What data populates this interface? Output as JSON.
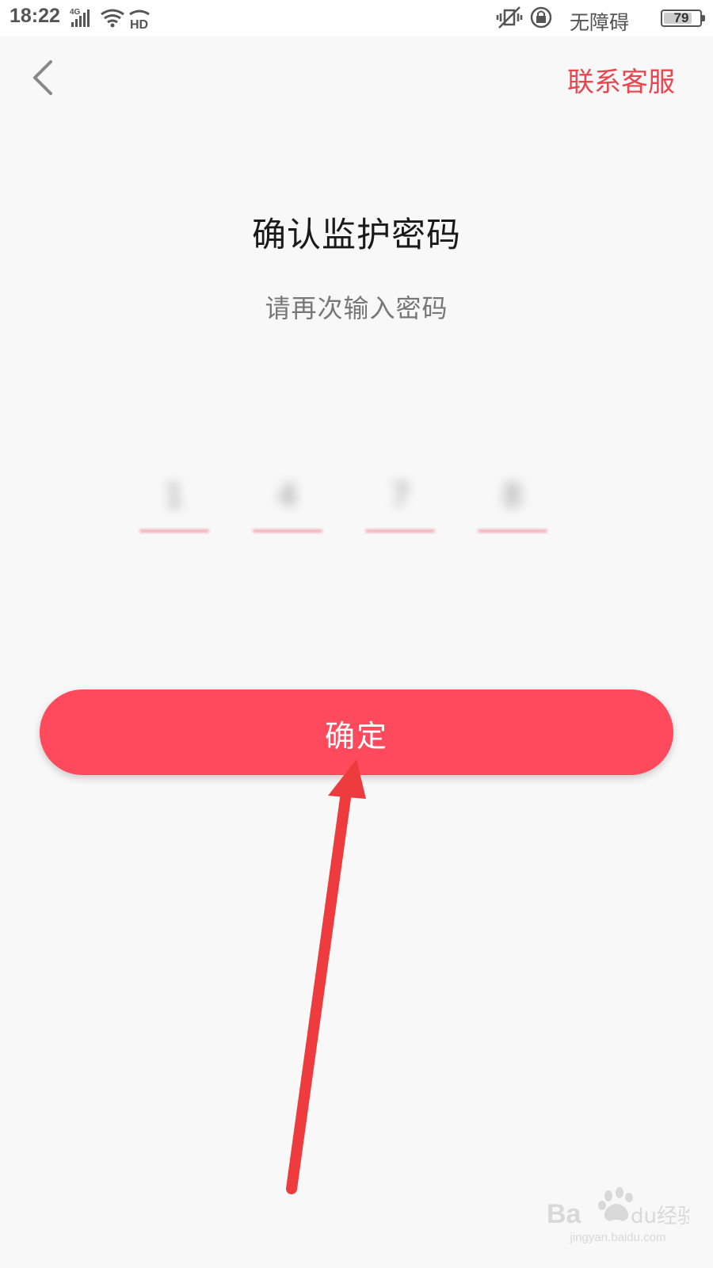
{
  "status_bar": {
    "time": "18:22",
    "network_type": "4G",
    "hd_label": "HD",
    "accessibility_label": "无障碍",
    "battery_level": "79",
    "battery_fraction": 0.79
  },
  "header": {
    "back_icon": "chevron-left-icon",
    "contact_label": "联系客服"
  },
  "main": {
    "title": "确认监护密码",
    "subtitle": "请再次输入密码",
    "pin_digits": [
      "1",
      "4",
      "7",
      "8"
    ],
    "confirm_label": "确定"
  },
  "watermark": {
    "brand": "Baidu经验",
    "url": "jingyan.baidu.com"
  },
  "colors": {
    "accent": "#fe4a5c",
    "link": "#e8464f",
    "annotation_arrow": "#ee3b3d",
    "background": "#f8f8f8"
  }
}
